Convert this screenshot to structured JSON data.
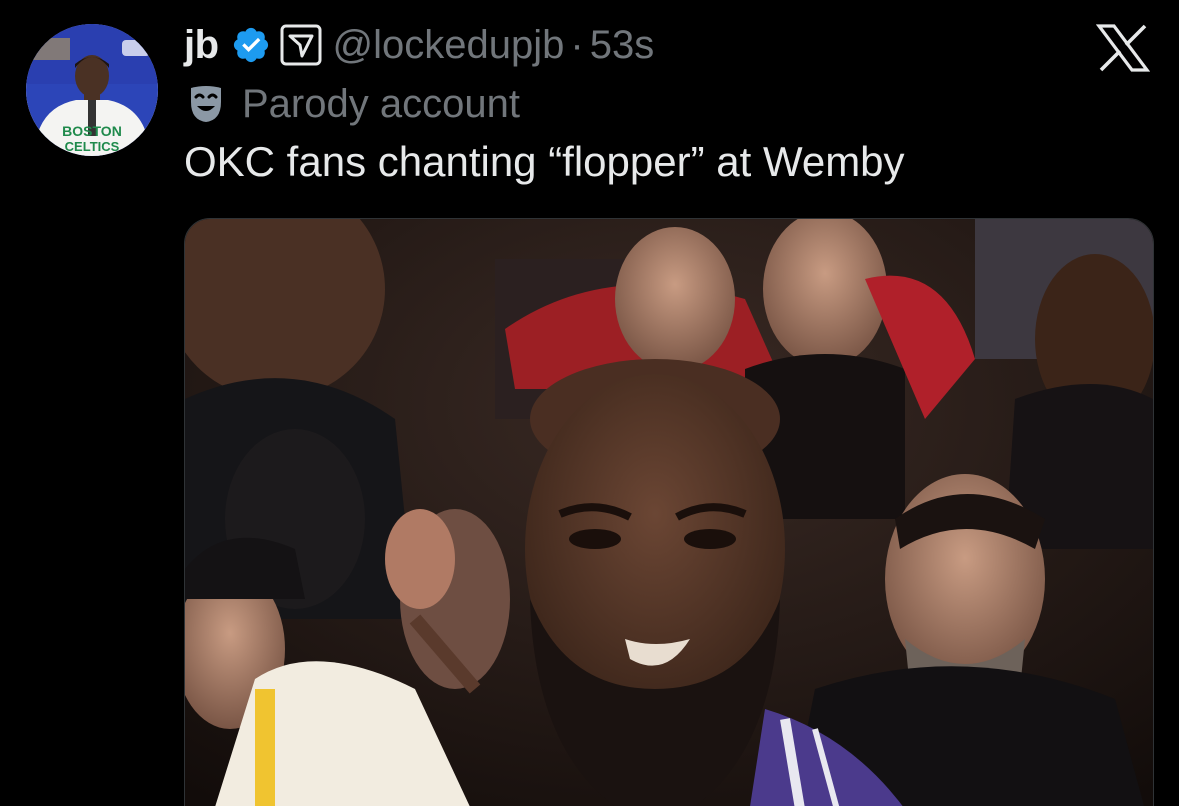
{
  "author": {
    "display_name": "jb",
    "handle": "@lockedupjb",
    "separator": "·",
    "time": "53s",
    "label": "Parody account",
    "avatar_text": [
      "BOSTON",
      "CELTICS"
    ]
  },
  "tweet": {
    "text": "OKC fans chanting “flopper” at Wemby"
  },
  "icons": {
    "verified": "verified-badge-icon",
    "affiliate": "affiliate-badge-icon",
    "parody": "theater-mask-icon",
    "brand": "x-logo-icon"
  },
  "colors": {
    "background": "#000000",
    "text_primary": "#e7e9ea",
    "text_secondary": "#71767b",
    "verified_blue": "#1d9bf0"
  }
}
